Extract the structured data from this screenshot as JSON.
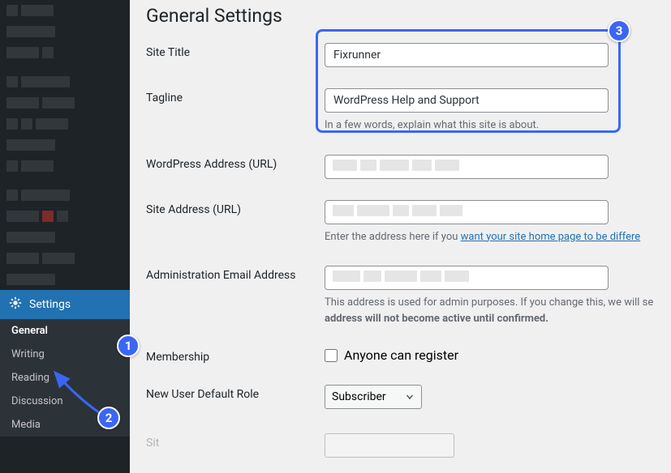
{
  "sidebar": {
    "settings_label": "Settings",
    "subs": [
      "General",
      "Writing",
      "Reading",
      "Discussion",
      "Media"
    ]
  },
  "page": {
    "title": "General Settings"
  },
  "fields": {
    "site_title": {
      "label": "Site Title",
      "value": "Fixrunner"
    },
    "tagline": {
      "label": "Tagline",
      "value": "WordPress Help and Support",
      "desc_prefix": "In a few words, explain what this site is about."
    },
    "wp_address": {
      "label": "WordPress Address (URL)",
      "value": ""
    },
    "site_address": {
      "label": "Site Address (URL)",
      "value": "",
      "desc_prefix": "Enter the address here if you ",
      "desc_link": "want your site home page to be differe"
    },
    "admin_email": {
      "label": "Administration Email Address",
      "value": "",
      "desc": "This address is used for admin purposes. If you change this, we will se",
      "desc_bold": "address will not become active until confirmed."
    },
    "membership": {
      "label": "Membership",
      "checkbox_label": "Anyone can register"
    },
    "default_role": {
      "label": "New User Default Role",
      "value": "Subscriber"
    },
    "site_lang": {
      "partial_value": ""
    }
  },
  "annotations": {
    "b1": "1",
    "b2": "2",
    "b3": "3"
  }
}
